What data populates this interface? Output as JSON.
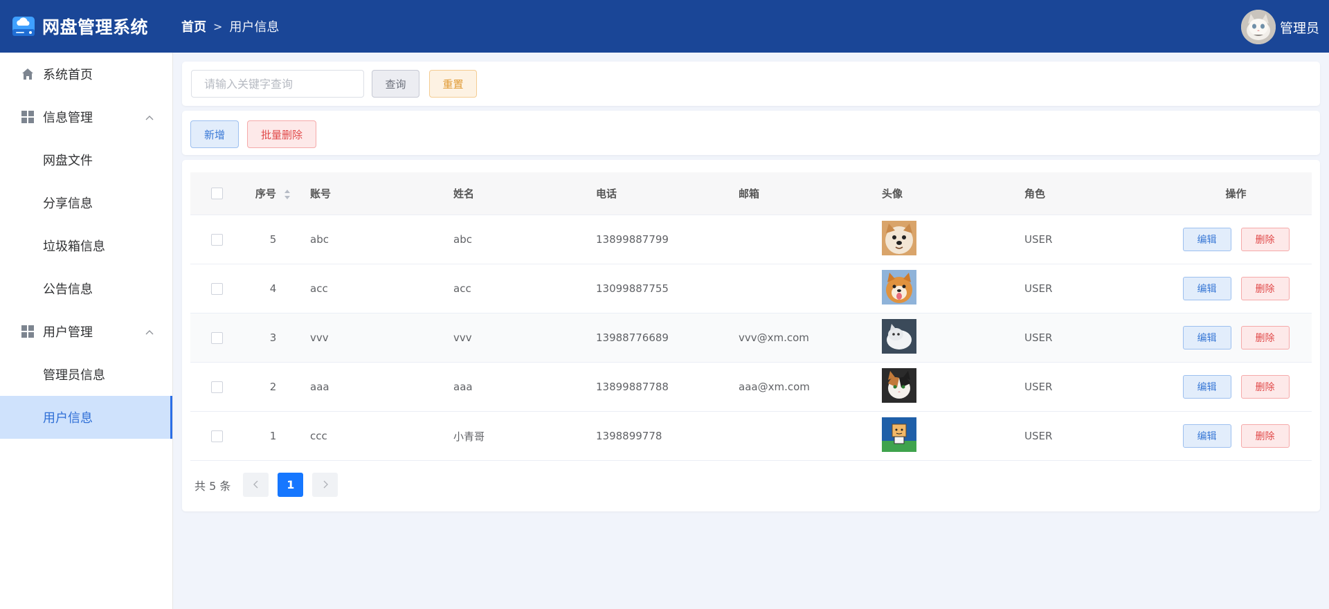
{
  "app": {
    "title": "网盘管理系统"
  },
  "breadcrumb": {
    "home": "首页",
    "separator": ">",
    "current": "用户信息"
  },
  "user": {
    "name": "管理员"
  },
  "sidebar": {
    "home": "系统首页",
    "info_group": "信息管理",
    "info_items": [
      "网盘文件",
      "分享信息",
      "垃圾箱信息",
      "公告信息"
    ],
    "user_group": "用户管理",
    "user_items": [
      "管理员信息",
      "用户信息"
    ]
  },
  "search": {
    "placeholder": "请输入关键字查询",
    "query_label": "查询",
    "reset_label": "重置"
  },
  "actions": {
    "add_label": "新增",
    "batch_delete_label": "批量删除"
  },
  "table": {
    "headers": {
      "seq": "序号",
      "account": "账号",
      "name": "姓名",
      "phone": "电话",
      "email": "邮箱",
      "avatar": "头像",
      "role": "角色",
      "ops": "操作"
    },
    "edit_label": "编辑",
    "delete_label": "删除",
    "rows": [
      {
        "seq": "5",
        "account": "abc",
        "name": "abc",
        "phone": "13899887799",
        "email": "",
        "role": "USER",
        "avatar": "shiba-dog-avatar"
      },
      {
        "seq": "4",
        "account": "acc",
        "name": "acc",
        "phone": "13099887755",
        "email": "",
        "role": "USER",
        "avatar": "shiba-tongue-avatar"
      },
      {
        "seq": "3",
        "account": "vvv",
        "name": "vvv",
        "phone": "13988776689",
        "email": "vvv@xm.com",
        "role": "USER",
        "avatar": "white-cat-avatar"
      },
      {
        "seq": "2",
        "account": "aaa",
        "name": "aaa",
        "phone": "13899887788",
        "email": "aaa@xm.com",
        "role": "USER",
        "avatar": "calico-cat-avatar"
      },
      {
        "seq": "1",
        "account": "ccc",
        "name": "小青哥",
        "phone": "1398899778",
        "email": "",
        "role": "USER",
        "avatar": "cartoon-box-avatar"
      }
    ]
  },
  "pagination": {
    "total_label": "共 5 条",
    "current_page": "1"
  },
  "colors": {
    "header": "#1a4697",
    "accent": "#1677ff",
    "active_menu_bg": "#cfe2fc"
  }
}
